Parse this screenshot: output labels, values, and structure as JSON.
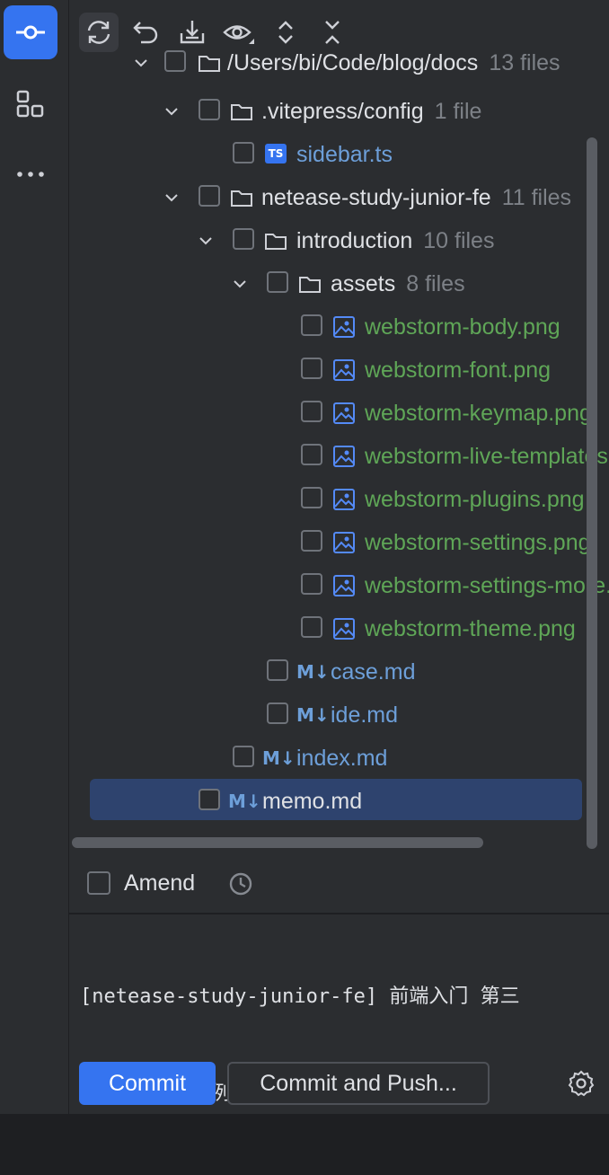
{
  "sidebar": {
    "items": [
      {
        "name": "commit-icon",
        "active": true
      },
      {
        "name": "structure-icon",
        "active": false
      },
      {
        "name": "more-icon",
        "active": false
      }
    ]
  },
  "toolbar": {
    "icons": [
      "refresh-icon",
      "rollback-icon",
      "update-icon",
      "eye-icon",
      "expand-icon",
      "collapse-icon"
    ]
  },
  "tree": {
    "rows": [
      {
        "label": "/Users/bi/Code/blog/docs",
        "count": "13 files",
        "kind": "dir"
      },
      {
        "label": ".vitepress/config",
        "count": "1 file",
        "kind": "dir"
      },
      {
        "label": "sidebar.ts",
        "count": "",
        "kind": "mod"
      },
      {
        "label": "netease-study-junior-fe",
        "count": "11 files",
        "kind": "dir"
      },
      {
        "label": "introduction",
        "count": "10 files",
        "kind": "dir"
      },
      {
        "label": "assets",
        "count": "8 files",
        "kind": "dir"
      },
      {
        "label": "webstorm-body.png",
        "count": "",
        "kind": "added"
      },
      {
        "label": "webstorm-font.png",
        "count": "",
        "kind": "added"
      },
      {
        "label": "webstorm-keymap.png",
        "count": "",
        "kind": "added"
      },
      {
        "label": "webstorm-live-templates.png",
        "count": "",
        "kind": "added"
      },
      {
        "label": "webstorm-plugins.png",
        "count": "",
        "kind": "added"
      },
      {
        "label": "webstorm-settings.png",
        "count": "",
        "kind": "added"
      },
      {
        "label": "webstorm-settings-more.png",
        "count": "",
        "kind": "added"
      },
      {
        "label": "webstorm-theme.png",
        "count": "",
        "kind": "added"
      },
      {
        "label": "case.md",
        "count": "",
        "kind": "mod"
      },
      {
        "label": "ide.md",
        "count": "",
        "kind": "mod"
      },
      {
        "label": "index.md",
        "count": "",
        "kind": "mod"
      },
      {
        "label": "memo.md",
        "count": "",
        "kind": "dir",
        "selected": true
      }
    ],
    "ts_badge": "TS",
    "md_badge": "M↓"
  },
  "amend": {
    "label": "Amend"
  },
  "commit_message": {
    "line1": "[netease-study-junior-fe] 前端入门 第三",
    "line2": "章 前端入门案例"
  },
  "buttons": {
    "commit": "Commit",
    "commit_and_push": "Commit and Push..."
  },
  "colors": {
    "accent": "#3574f0",
    "added": "#5fa657",
    "modified": "#6d9fd9",
    "selection": "#2e436e"
  }
}
